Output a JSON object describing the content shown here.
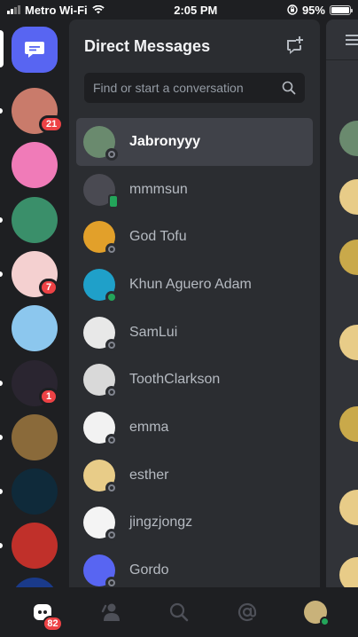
{
  "status_bar": {
    "carrier": "Metro Wi-Fi",
    "time": "2:05 PM",
    "battery": "95%"
  },
  "servers": [
    {
      "name": "server-1",
      "badge": "21",
      "color": "#c97b6b",
      "unread": true
    },
    {
      "name": "server-2",
      "badge": null,
      "color": "#f07bb8",
      "unread": false
    },
    {
      "name": "server-3",
      "badge": null,
      "color": "#3a8f6a",
      "unread": true
    },
    {
      "name": "server-4",
      "badge": "7",
      "color": "#f4d0d0",
      "unread": true
    },
    {
      "name": "server-5",
      "badge": null,
      "color": "#8cc7ee",
      "unread": false
    },
    {
      "name": "server-6",
      "badge": "1",
      "color": "#2a2530",
      "unread": true
    },
    {
      "name": "server-7",
      "badge": null,
      "color": "#8a6a3a",
      "unread": true
    },
    {
      "name": "server-8",
      "badge": null,
      "color": "#0f2a3a",
      "unread": true
    },
    {
      "name": "server-9",
      "badge": null,
      "color": "#c0302a",
      "unread": true
    },
    {
      "name": "server-10",
      "badge": null,
      "color": "#1a3a8a",
      "unread": false
    }
  ],
  "dm_panel": {
    "title": "Direct Messages",
    "search_placeholder": "Find or start a conversation",
    "conversations": [
      {
        "name": "Jabronyyy",
        "status": "offline",
        "active": true,
        "avatar_color": "#6a8a6e"
      },
      {
        "name": "mmmsun",
        "status": "mobile",
        "active": false,
        "avatar_color": "#4a4a52"
      },
      {
        "name": "God Tofu",
        "status": "offline",
        "active": false,
        "avatar_color": "#e2a02a"
      },
      {
        "name": "Khun Aguero Adam",
        "status": "online",
        "active": false,
        "avatar_color": "#1fa0c9"
      },
      {
        "name": "SamLui",
        "status": "offline",
        "active": false,
        "avatar_color": "#e8e8e8"
      },
      {
        "name": "ToothClarkson",
        "status": "offline",
        "active": false,
        "avatar_color": "#d9d9d9"
      },
      {
        "name": "emma",
        "status": "offline",
        "active": false,
        "avatar_color": "#f2f2f2"
      },
      {
        "name": "esther",
        "status": "offline",
        "active": false,
        "avatar_color": "#e8cc88"
      },
      {
        "name": "jingzjongz",
        "status": "offline",
        "active": false,
        "avatar_color": "#f4f4f4"
      },
      {
        "name": "Gordo",
        "status": "offline",
        "active": false,
        "avatar_color": "#5865f2"
      }
    ]
  },
  "tab_bar": {
    "home_badge": "82",
    "tabs": [
      "home",
      "friends",
      "search",
      "mentions",
      "profile"
    ]
  },
  "colors": {
    "blurple": "#5865f2",
    "danger": "#ed4245",
    "online": "#23a55a"
  }
}
